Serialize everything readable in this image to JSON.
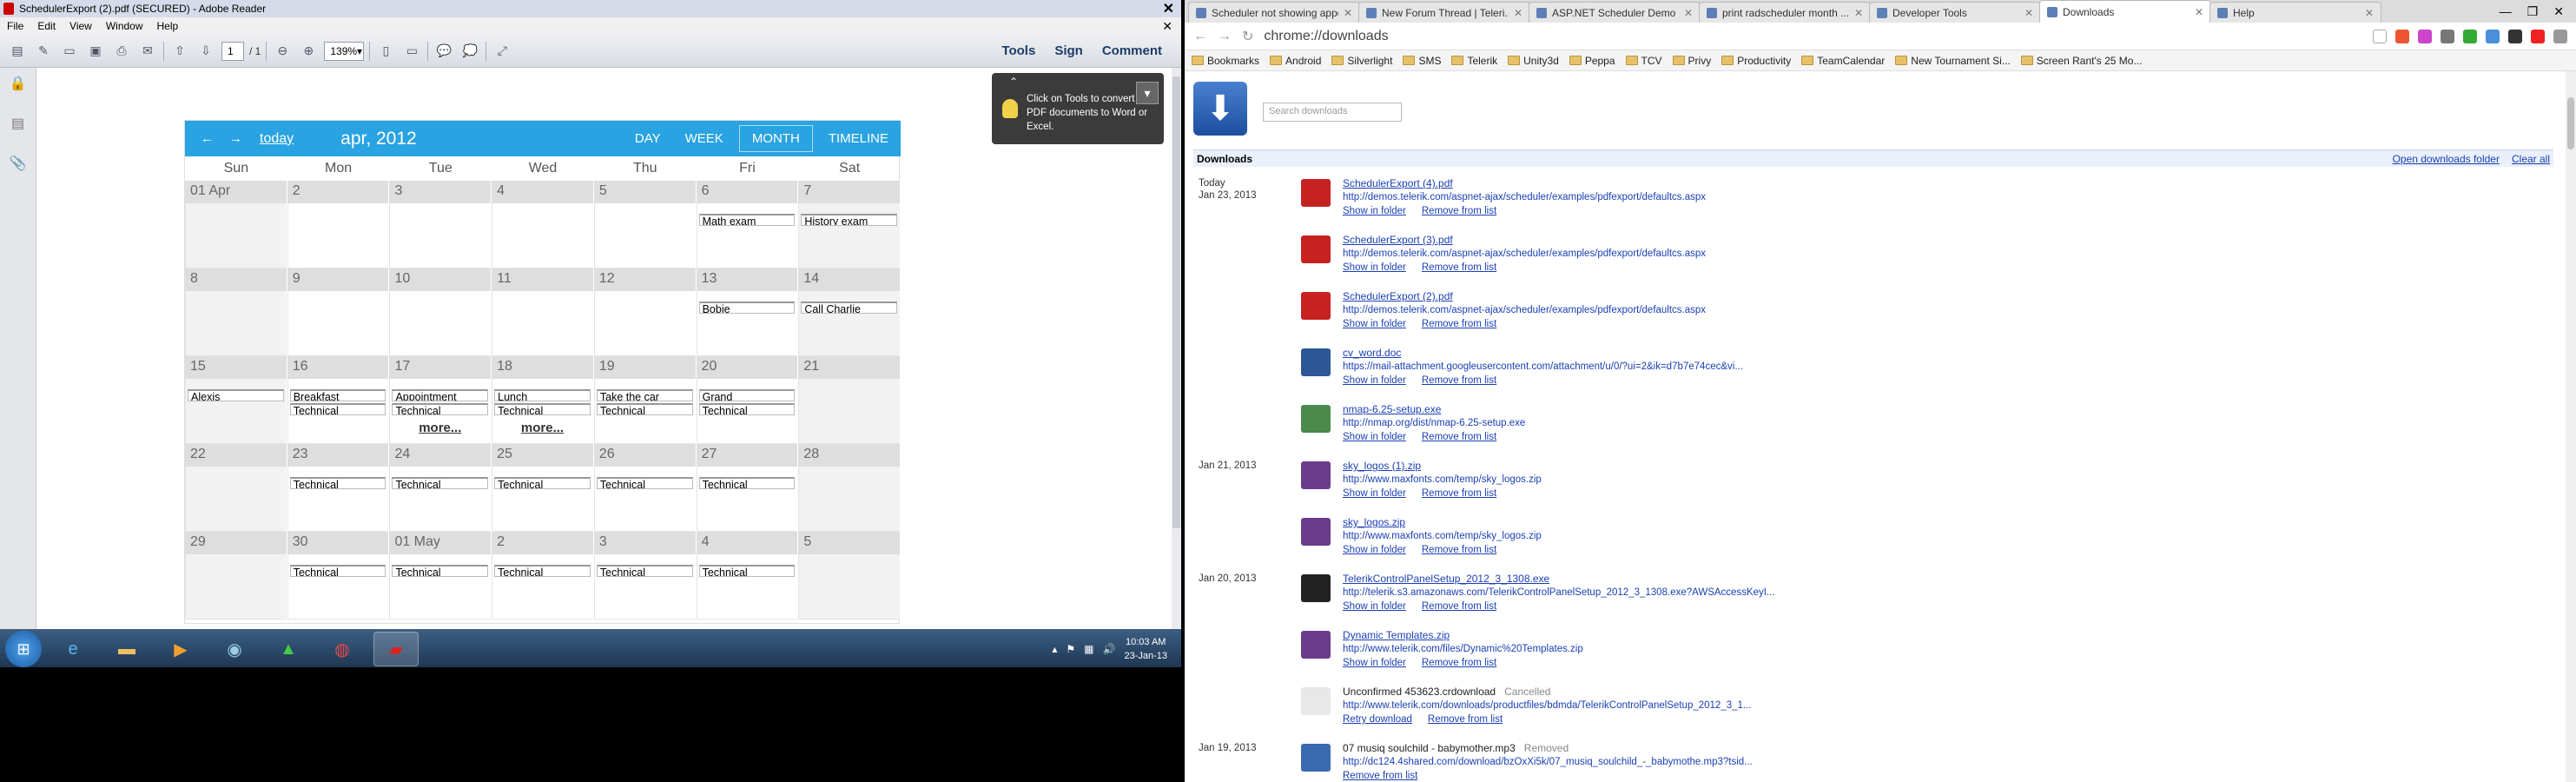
{
  "adobe": {
    "title": "SchedulerExport (2).pdf (SECURED) - Adobe Reader",
    "menu": [
      "File",
      "Edit",
      "View",
      "Window",
      "Help"
    ],
    "page_current": "1",
    "page_total": "/ 1",
    "zoom": "139%",
    "right_tools": [
      "Tools",
      "Sign",
      "Comment"
    ],
    "tooltip": "Click on Tools to convert PDF documents to Word or Excel."
  },
  "scheduler": {
    "today_label": "today",
    "date_label": "apr, 2012",
    "views": [
      "DAY",
      "WEEK",
      "MONTH",
      "TIMELINE"
    ],
    "selected_view": "MONTH",
    "day_headers": [
      "Sun",
      "Mon",
      "Tue",
      "Wed",
      "Thu",
      "Fri",
      "Sat"
    ],
    "weeks": [
      {
        "days": [
          "01 Apr",
          "2",
          "3",
          "4",
          "5",
          "6",
          "7"
        ],
        "events1": [
          "",
          "",
          "",
          "",
          "",
          "Math exam",
          "History exam"
        ],
        "events2": [
          "",
          "",
          "",
          "",
          "",
          "",
          ""
        ],
        "more": [
          "",
          "",
          "",
          "",
          "",
          "",
          ""
        ]
      },
      {
        "days": [
          "8",
          "9",
          "10",
          "11",
          "12",
          "13",
          "14"
        ],
        "events1": [
          "",
          "",
          "",
          "",
          "",
          "Bobie",
          "Call Charlie"
        ],
        "events2": [
          "",
          "",
          "",
          "",
          "",
          "",
          ""
        ],
        "more": [
          "",
          "",
          "",
          "",
          "",
          "",
          ""
        ]
      },
      {
        "days": [
          "15",
          "16",
          "17",
          "18",
          "19",
          "20",
          "21"
        ],
        "events1": [
          "Alexis",
          "Breakfast",
          "Appointment",
          "Lunch",
          "Take the car",
          "Grand",
          ""
        ],
        "events2": [
          "",
          "Technical",
          "Technical",
          "Technical",
          "Technical",
          "Technical",
          ""
        ],
        "more": [
          "",
          "",
          "more...",
          "more...",
          "",
          "",
          ""
        ]
      },
      {
        "days": [
          "22",
          "23",
          "24",
          "25",
          "26",
          "27",
          "28"
        ],
        "events1": [
          "",
          "Technical",
          "Technical",
          "Technical",
          "Technical",
          "Technical",
          ""
        ],
        "events2": [
          "",
          "",
          "",
          "",
          "",
          "",
          ""
        ],
        "more": [
          "",
          "",
          "",
          "",
          "",
          "",
          ""
        ]
      },
      {
        "days": [
          "29",
          "30",
          "01 May",
          "2",
          "3",
          "4",
          "5"
        ],
        "events1": [
          "",
          "Technical",
          "Technical",
          "Technical",
          "Technical",
          "Technical",
          ""
        ],
        "events2": [
          "",
          "",
          "",
          "",
          "",
          "",
          ""
        ],
        "more": [
          "",
          "",
          "",
          "",
          "",
          "",
          ""
        ]
      }
    ]
  },
  "taskbar": {
    "time": "10:03 AM",
    "date": "23-Jan-13"
  },
  "chrome": {
    "tabs": [
      "Scheduler not showing appo...",
      "New Forum Thread | Teleri...",
      "ASP.NET Scheduler Demo ...",
      "print radscheduler month ...",
      "Developer Tools",
      "Downloads",
      "Help"
    ],
    "active_tab": "Downloads",
    "url": "chrome://downloads",
    "bookmarks": [
      "Bookmarks",
      "Android",
      "Silverlight",
      "SMS",
      "Telerik",
      "Unity3d",
      "Peppa",
      "TCV",
      "Privy",
      "Productivity",
      "TeamCalendar",
      "New Tournament Si...",
      "Screen Rant's 25 Mo..."
    ]
  },
  "downloads": {
    "search_placeholder": "Search downloads",
    "heading": "Downloads",
    "open_folder": "Open downloads folder",
    "clear_all": "Clear all",
    "entries": [
      {
        "date1": "Today",
        "date2": "Jan 23, 2013",
        "name": "SchedulerExport (4).pdf",
        "status": "",
        "url": "http://demos.telerik.com/aspnet-ajax/scheduler/examples/pdfexport/defaultcs.aspx",
        "act1": "Show in folder",
        "act2": "Remove from list",
        "icon_color": "#c62222"
      },
      {
        "date1": "",
        "date2": "",
        "name": "SchedulerExport (3).pdf",
        "status": "",
        "url": "http://demos.telerik.com/aspnet-ajax/scheduler/examples/pdfexport/defaultcs.aspx",
        "act1": "Show in folder",
        "act2": "Remove from list",
        "icon_color": "#c62222"
      },
      {
        "date1": "",
        "date2": "",
        "name": "SchedulerExport (2).pdf",
        "status": "",
        "url": "http://demos.telerik.com/aspnet-ajax/scheduler/examples/pdfexport/defaultcs.aspx",
        "act1": "Show in folder",
        "act2": "Remove from list",
        "icon_color": "#c62222"
      },
      {
        "date1": "",
        "date2": "",
        "name": "cv_word.doc",
        "status": "",
        "url": "https://mail-attachment.googleusercontent.com/attachment/u/0/?ui=2&ik=d7b7e74cec&vi...",
        "act1": "Show in folder",
        "act2": "Remove from list",
        "icon_color": "#2b5797"
      },
      {
        "date1": "",
        "date2": "",
        "name": "nmap-6.25-setup.exe",
        "status": "",
        "url": "http://nmap.org/dist/nmap-6.25-setup.exe",
        "act1": "Show in folder",
        "act2": "Remove from list",
        "icon_color": "#4a8a4a"
      },
      {
        "date1": "Jan 21, 2013",
        "date2": "",
        "name": "sky_logos (1).zip",
        "status": "",
        "url": "http://www.maxfonts.com/temp/sky_logos.zip",
        "act1": "Show in folder",
        "act2": "Remove from list",
        "icon_color": "#6a3c8c"
      },
      {
        "date1": "",
        "date2": "",
        "name": "sky_logos.zip",
        "status": "",
        "url": "http://www.maxfonts.com/temp/sky_logos.zip",
        "act1": "Show in folder",
        "act2": "Remove from list",
        "icon_color": "#6a3c8c"
      },
      {
        "date1": "Jan 20, 2013",
        "date2": "",
        "name": "TelerikControlPanelSetup_2012_3_1308.exe",
        "status": "",
        "url": "http://telerik.s3.amazonaws.com/TelerikControlPanelSetup_2012_3_1308.exe?AWSAccessKeyI...",
        "act1": "Show in folder",
        "act2": "Remove from list",
        "icon_color": "#222222"
      },
      {
        "date1": "",
        "date2": "",
        "name": "Dynamic Templates.zip",
        "status": "",
        "url": "http://www.telerik.com/files/Dynamic%20Templates.zip",
        "act1": "Show in folder",
        "act2": "Remove from list",
        "icon_color": "#6a3c8c"
      },
      {
        "date1": "",
        "date2": "",
        "name": "Unconfirmed 453623.crdownload",
        "status": "Cancelled",
        "url": "http://www.telerik.com/downloads/productfiles/bdmda/TelerikControlPanelSetup_2012_3_1...",
        "act1": "Retry download",
        "act2": "Remove from list",
        "icon_color": "#e8e8e8"
      },
      {
        "date1": "Jan 19, 2013",
        "date2": "",
        "name": "07 musiq soulchild - babymother.mp3",
        "status": "Removed",
        "url": "http://dc124.4shared.com/download/bzOxXi5k/07_musiq_soulchild_-_babymothe.mp3?tsid...",
        "act1": "",
        "act2": "Remove from list",
        "icon_color": "#3a6ab0"
      }
    ]
  }
}
